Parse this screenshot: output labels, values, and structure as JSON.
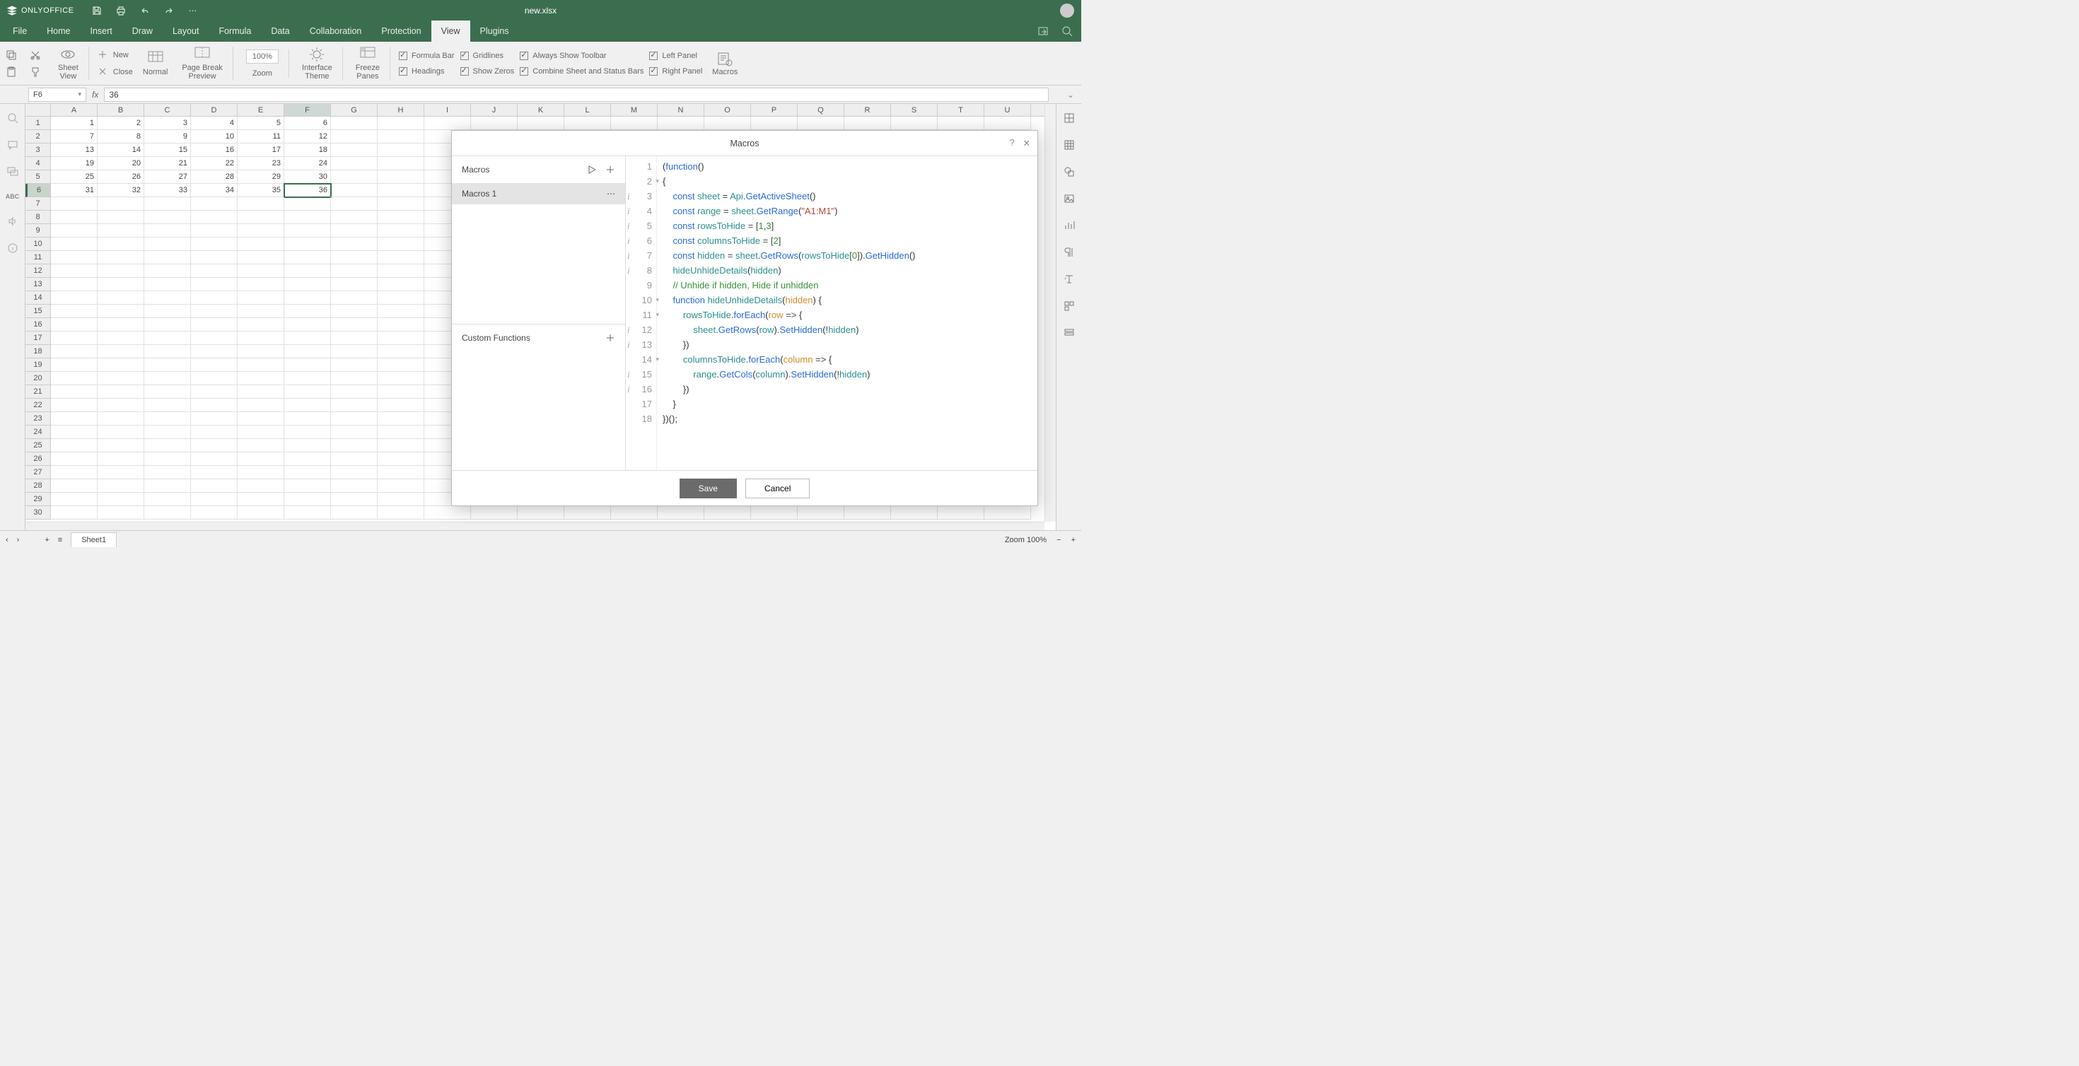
{
  "app": {
    "brand": "ONLYOFFICE",
    "filename": "new.xlsx"
  },
  "menus": [
    "File",
    "Home",
    "Insert",
    "Draw",
    "Layout",
    "Formula",
    "Data",
    "Collaboration",
    "Protection",
    "View",
    "Plugins"
  ],
  "active_menu": "View",
  "ribbon": {
    "new": "New",
    "close": "Close",
    "sheet_view": "Sheet\nView",
    "normal": "Normal",
    "page_break": "Page Break\nPreview",
    "zoom_val": "100%",
    "zoom": "Zoom",
    "iface": "Interface\nTheme",
    "freeze": "Freeze\nPanes",
    "formula_bar": "Formula Bar",
    "gridlines": "Gridlines",
    "headings": "Headings",
    "show_zeros": "Show Zeros",
    "always_toolbar": "Always Show Toolbar",
    "combine": "Combine Sheet and Status Bars",
    "left_panel": "Left Panel",
    "right_panel": "Right Panel",
    "macros": "Macros"
  },
  "ribbon_checks": {
    "formula_bar": true,
    "gridlines": true,
    "headings": true,
    "show_zeros": true,
    "always_toolbar": true,
    "combine": true,
    "left_panel": true,
    "right_panel": true
  },
  "namebox": "F6",
  "formula_value": "36",
  "columns": [
    "A",
    "B",
    "C",
    "D",
    "E",
    "F",
    "G",
    "H",
    "I",
    "J",
    "K",
    "L",
    "M",
    "N",
    "O",
    "P",
    "Q",
    "R",
    "S",
    "T",
    "U"
  ],
  "selected_col": "F",
  "row_count": 30,
  "selected_row": 6,
  "cells": [
    [
      1,
      2,
      3,
      4,
      5,
      6
    ],
    [
      7,
      8,
      9,
      10,
      11,
      12
    ],
    [
      13,
      14,
      15,
      16,
      17,
      18
    ],
    [
      19,
      20,
      21,
      22,
      23,
      24
    ],
    [
      25,
      26,
      27,
      28,
      29,
      30
    ],
    [
      31,
      32,
      33,
      34,
      35,
      36
    ]
  ],
  "active_cell": {
    "r": 5,
    "c": 5
  },
  "sheet_tab": "Sheet1",
  "zoom_status": "Zoom 100%",
  "dialog": {
    "title": "Macros",
    "sec_macros": "Macros",
    "macro_item": "Macros 1",
    "sec_custom": "Custom Functions",
    "save": "Save",
    "cancel": "Cancel",
    "code_lines": [
      {
        "n": 1,
        "info": false,
        "fold": false
      },
      {
        "n": 2,
        "info": false,
        "fold": true
      },
      {
        "n": 3,
        "info": true,
        "fold": false
      },
      {
        "n": 4,
        "info": true,
        "fold": false
      },
      {
        "n": 5,
        "info": true,
        "fold": false
      },
      {
        "n": 6,
        "info": true,
        "fold": false
      },
      {
        "n": 7,
        "info": true,
        "fold": false
      },
      {
        "n": 8,
        "info": true,
        "fold": false
      },
      {
        "n": 9,
        "info": false,
        "fold": false
      },
      {
        "n": 10,
        "info": false,
        "fold": true
      },
      {
        "n": 11,
        "info": false,
        "fold": true
      },
      {
        "n": 12,
        "info": true,
        "fold": false
      },
      {
        "n": 13,
        "info": true,
        "fold": false
      },
      {
        "n": 14,
        "info": false,
        "fold": true
      },
      {
        "n": 15,
        "info": true,
        "fold": false
      },
      {
        "n": 16,
        "info": true,
        "fold": false
      },
      {
        "n": 17,
        "info": false,
        "fold": false
      },
      {
        "n": 18,
        "info": false,
        "fold": false
      }
    ]
  }
}
